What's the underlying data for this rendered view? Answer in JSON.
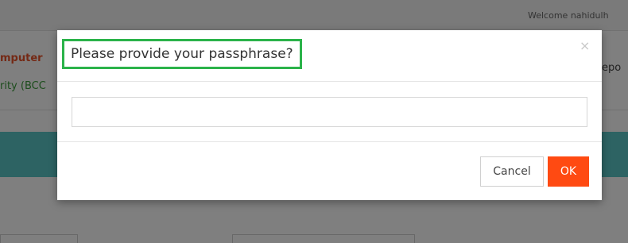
{
  "background_page": {
    "welcome_text": "Welcome nahidulh",
    "brand_line1": "mputer",
    "brand_line2": "rity (BCC",
    "right_fragment": "epo"
  },
  "dialog": {
    "title": "Please provide your passphrase?",
    "close_glyph": "×",
    "input": {
      "value": "",
      "placeholder": ""
    },
    "cancel_label": "Cancel",
    "ok_label": "OK"
  },
  "colors": {
    "ok_button": "#ff4a12",
    "title_highlight_border": "#2bb34a",
    "background_band": "#5bc6c6"
  }
}
